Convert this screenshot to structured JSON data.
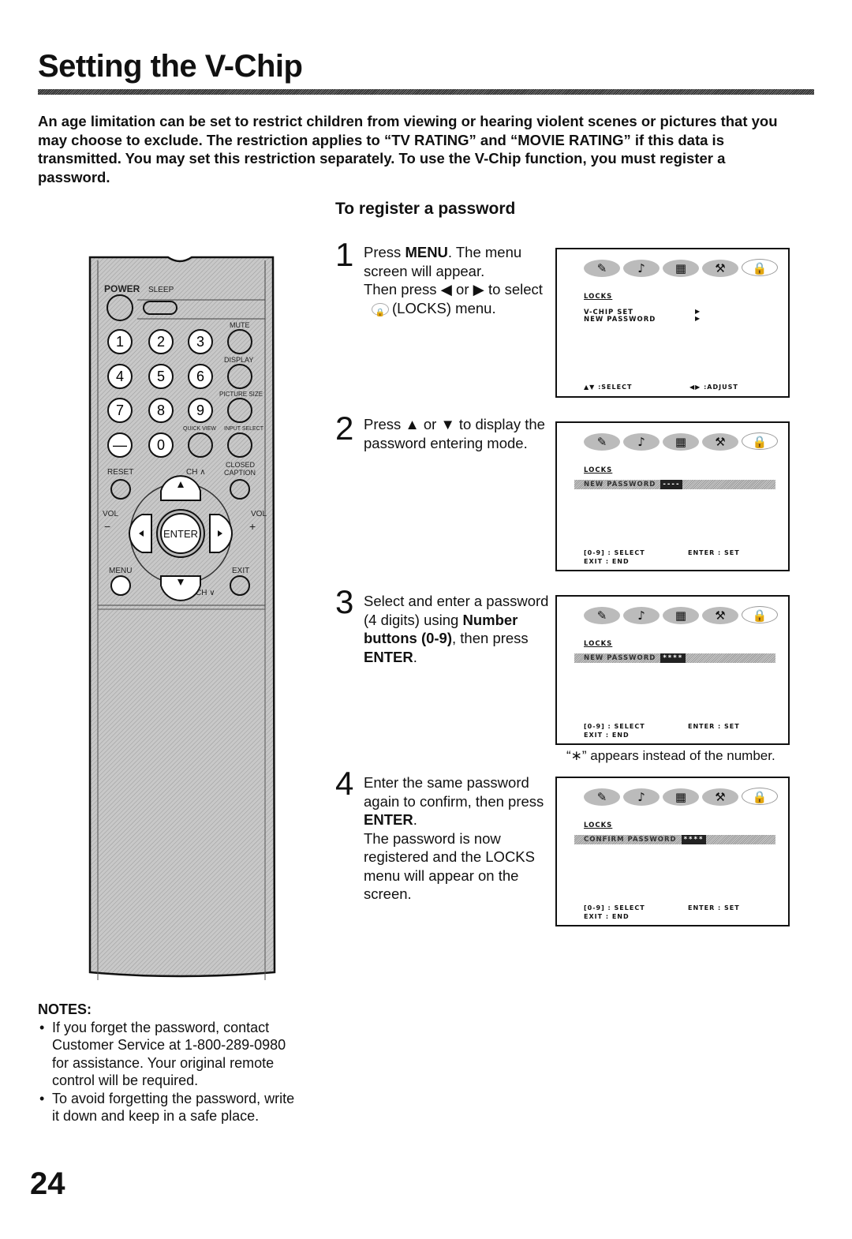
{
  "title": "Setting the V-Chip",
  "intro": "An age limitation can be set to restrict children from viewing or hearing violent scenes or pictures that you may choose to exclude. The restriction applies to “TV RATING” and “MOVIE RATING” if this data is transmitted. You may set this restriction separately. To use the V-Chip function, you must register a password.",
  "subtitle": "To register a password",
  "steps": [
    {
      "num": "1",
      "a": "Press ",
      "b": "MENU",
      "c": ". The menu screen will appear.",
      "d": "Then press ◀ or ▶ to select",
      "e": "(LOCKS) menu."
    },
    {
      "num": "2",
      "text": "Press ▲ or ▼ to display the password entering mode."
    },
    {
      "num": "3",
      "a": "Select and enter a password (4 digits) using ",
      "b": "Number buttons (0-9)",
      "c": ", then press ",
      "d": "ENTER",
      "e": "."
    },
    {
      "num": "4",
      "a": "Enter the same password again to confirm, then press ",
      "b": "ENTER",
      "c": ".",
      "d": "The password is now registered and the LOCKS menu will appear on the screen."
    }
  ],
  "screens": [
    {
      "menu_title": "LOCKS",
      "items": [
        "V-CHIP SET",
        "NEW PASSWORD"
      ],
      "foot_left": "▲▼ :SELECT",
      "foot_right": "◀▶ :ADJUST"
    },
    {
      "menu_title": "LOCKS",
      "field": "NEW PASSWORD",
      "value": "----",
      "foot_left": "[0-9] : SELECT",
      "foot_right": "ENTER : SET",
      "foot_left2": "EXIT : END"
    },
    {
      "menu_title": "LOCKS",
      "field": "NEW PASSWORD",
      "value": "****",
      "foot_left": "[0-9] : SELECT",
      "foot_right": "ENTER : SET",
      "foot_left2": "EXIT : END"
    },
    {
      "menu_title": "LOCKS",
      "field": "CONFIRM PASSWORD",
      "value": "****",
      "foot_left": "[0-9] : SELECT",
      "foot_right": "ENTER : SET",
      "foot_left2": "EXIT : END"
    }
  ],
  "caption": "“∗” appears instead of the number.",
  "remote": {
    "power": "POWER",
    "sleep": "SLEEP",
    "mute": "MUTE",
    "display": "DISPLAY",
    "picture_size": "PICTURE SIZE",
    "quick_view": "QUICK VIEW",
    "input_select": "INPUT SELECT",
    "reset": "RESET",
    "ch_up": "CH ∧",
    "closed": "CLOSED",
    "caption": "CAPTION",
    "vol_l": "VOL",
    "vol_r": "VOL",
    "minus": "−",
    "plus": "+",
    "enter": "ENTER",
    "menu": "MENU",
    "exit": "EXIT",
    "ch_down": "CH ∨",
    "digits": [
      "1",
      "2",
      "3",
      "4",
      "5",
      "6",
      "7",
      "8",
      "9",
      "—",
      "0"
    ]
  },
  "notes": {
    "heading": "NOTES:",
    "items": [
      "If you forget the password, contact Customer Service at 1-800-289-0980 for assistance. Your original remote control will be required.",
      "To avoid forgetting the password, write it down and keep in a safe place."
    ]
  },
  "page_number": "24"
}
